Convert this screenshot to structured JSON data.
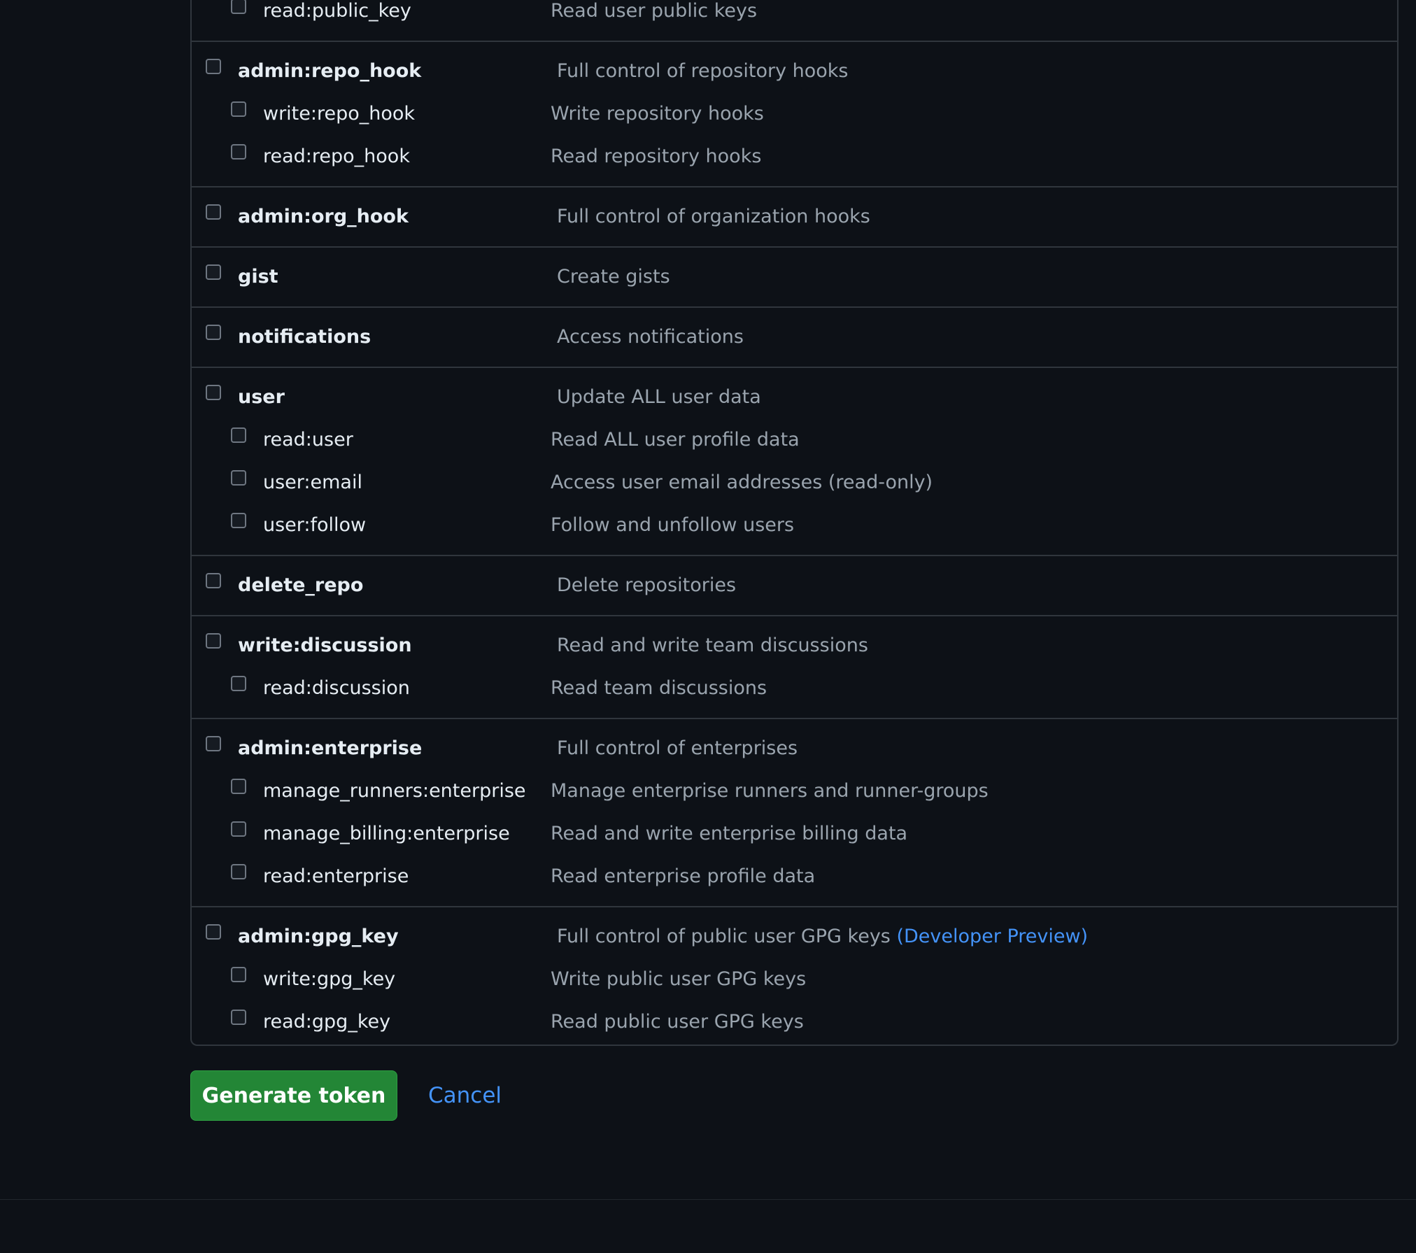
{
  "scope_groups": [
    {
      "subs": [
        {
          "name": "read:public_key",
          "description": "Read user public keys"
        }
      ]
    },
    {
      "name": "admin:repo_hook",
      "description": "Full control of repository hooks",
      "subs": [
        {
          "name": "write:repo_hook",
          "description": "Write repository hooks"
        },
        {
          "name": "read:repo_hook",
          "description": "Read repository hooks"
        }
      ]
    },
    {
      "name": "admin:org_hook",
      "description": "Full control of organization hooks",
      "subs": []
    },
    {
      "name": "gist",
      "description": "Create gists",
      "subs": []
    },
    {
      "name": "notifications",
      "description": "Access notifications",
      "subs": []
    },
    {
      "name": "user",
      "description": "Update ALL user data",
      "subs": [
        {
          "name": "read:user",
          "description": "Read ALL user profile data"
        },
        {
          "name": "user:email",
          "description": "Access user email addresses (read-only)"
        },
        {
          "name": "user:follow",
          "description": "Follow and unfollow users"
        }
      ]
    },
    {
      "name": "delete_repo",
      "description": "Delete repositories",
      "subs": []
    },
    {
      "name": "write:discussion",
      "description": "Read and write team discussions",
      "subs": [
        {
          "name": "read:discussion",
          "description": "Read team discussions"
        }
      ]
    },
    {
      "name": "admin:enterprise",
      "description": "Full control of enterprises",
      "subs": [
        {
          "name": "manage_runners:enterprise",
          "description": "Manage enterprise runners and runner-groups"
        },
        {
          "name": "manage_billing:enterprise",
          "description": "Read and write enterprise billing data"
        },
        {
          "name": "read:enterprise",
          "description": "Read enterprise profile data"
        }
      ]
    },
    {
      "name": "admin:gpg_key",
      "description": "Full control of public user GPG keys",
      "link": "(Developer Preview)",
      "subs": [
        {
          "name": "write:gpg_key",
          "description": "Write public user GPG keys"
        },
        {
          "name": "read:gpg_key",
          "description": "Read public user GPG keys"
        }
      ]
    }
  ],
  "actions": {
    "generate_label": "Generate token",
    "cancel_label": "Cancel"
  },
  "colors": {
    "background": "#0d1117",
    "border": "#30363d",
    "primary_button": "#238636",
    "link": "#4493f8",
    "muted_text": "#9aa4ae"
  }
}
